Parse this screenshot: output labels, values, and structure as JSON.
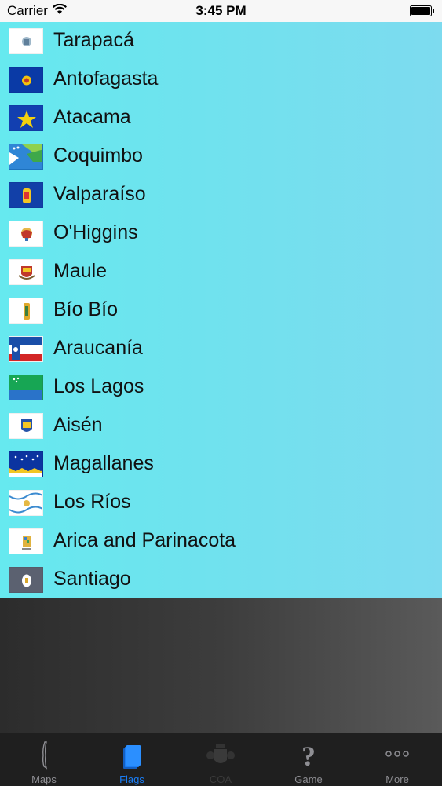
{
  "status_bar": {
    "carrier": "Carrier",
    "time": "3:45 PM"
  },
  "regions": [
    {
      "label": "Tarapacá",
      "flag_icon": "tarapaca-flag-icon"
    },
    {
      "label": "Antofagasta",
      "flag_icon": "antofagasta-flag-icon"
    },
    {
      "label": "Atacama",
      "flag_icon": "atacama-flag-icon"
    },
    {
      "label": "Coquimbo",
      "flag_icon": "coquimbo-flag-icon"
    },
    {
      "label": "Valparaíso",
      "flag_icon": "valparaiso-flag-icon"
    },
    {
      "label": "O'Higgins",
      "flag_icon": "ohiggins-flag-icon"
    },
    {
      "label": "Maule",
      "flag_icon": "maule-flag-icon"
    },
    {
      "label": "Bío Bío",
      "flag_icon": "biobio-flag-icon"
    },
    {
      "label": "Araucanía",
      "flag_icon": "araucania-flag-icon"
    },
    {
      "label": "Los Lagos",
      "flag_icon": "loslagos-flag-icon"
    },
    {
      "label": "Aisén",
      "flag_icon": "aisen-flag-icon"
    },
    {
      "label": "Magallanes",
      "flag_icon": "magallanes-flag-icon"
    },
    {
      "label": "Los Ríos",
      "flag_icon": "losrios-flag-icon"
    },
    {
      "label": "Arica and Parinacota",
      "flag_icon": "arica-flag-icon"
    },
    {
      "label": "Santiago",
      "flag_icon": "santiago-flag-icon"
    }
  ],
  "tab_bar": {
    "tabs": [
      {
        "label": "Maps",
        "icon": "map-outline-icon",
        "state": "inactive"
      },
      {
        "label": "Flags",
        "icon": "flags-icon",
        "state": "active"
      },
      {
        "label": "COA",
        "icon": "coat-of-arms-icon",
        "state": "disabled"
      },
      {
        "label": "Game",
        "icon": "question-mark-icon",
        "state": "inactive"
      },
      {
        "label": "More",
        "icon": "more-dots-icon",
        "state": "inactive"
      }
    ]
  },
  "colors": {
    "list_gradient_start": "#66e9ef",
    "list_gradient_end": "#7ddbef",
    "active_tab": "#1a7ef7",
    "inactive_tab": "#8e8e93"
  }
}
